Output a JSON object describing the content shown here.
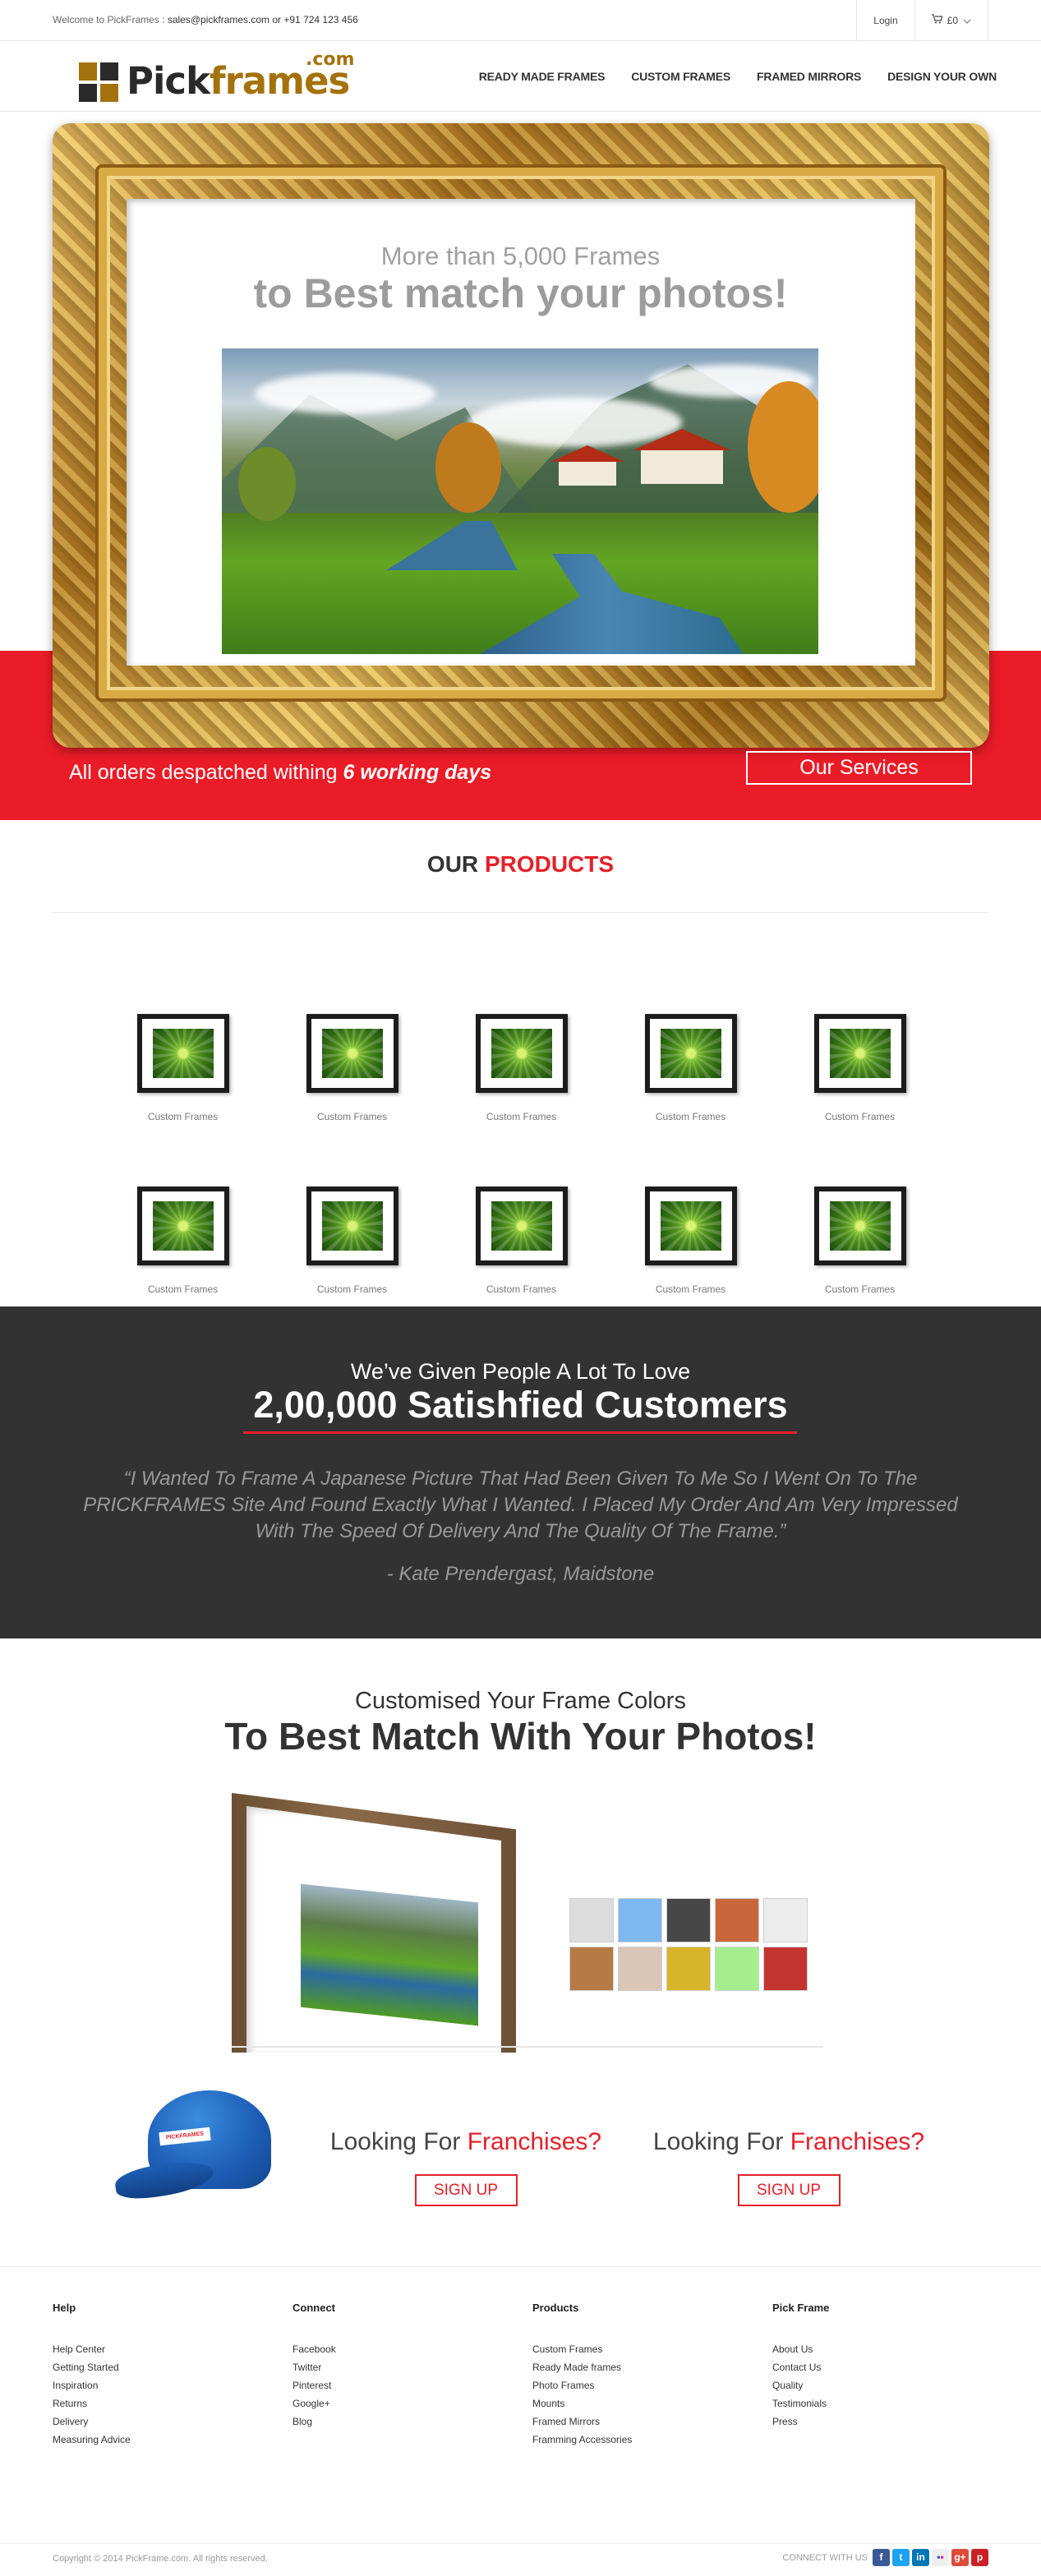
{
  "topbar": {
    "welcome_prefix": "Welcome to PickFrames :",
    "contact": "sales@pickframes.com or +91 724 123 456",
    "login": "Login",
    "cart": "£0"
  },
  "brand": {
    "pick": "Pick",
    "frames": "frames",
    "com": ".com"
  },
  "nav": [
    "READY MADE FRAMES",
    "CUSTOM FRAMES",
    "FRAMED MIRRORS",
    "DESIGN YOUR OWN"
  ],
  "hero": {
    "subtitle": "More than 5,000 Frames",
    "title": "to Best match your photos!",
    "despatch_text": "All orders despatched withing",
    "despatch_highlight": "6 working days",
    "services_button": "Our Services"
  },
  "products": {
    "heading_prefix": "OUR",
    "heading_highlight": "PRODUCTS",
    "items": [
      "Custom Frames",
      "Custom Frames",
      "Custom Frames",
      "Custom Frames",
      "Custom Frames",
      "Custom Frames",
      "Custom Frames",
      "Custom Frames",
      "Custom Frames",
      "Custom Frames"
    ]
  },
  "testimonial": {
    "lead": "We’ve Given People A Lot To Love",
    "headline": "2,00,000 Satishfied Customers",
    "quote": "“I Wanted To Frame A Japanese Picture That Had Been Given To Me So I Went On To The PRICKFRAMES Site And Found Exactly What I Wanted. I Placed My Order And Am Very Impressed With The Speed Of Delivery And The Quality Of The Frame.”",
    "author": "- Kate Prendergast, Maidstone"
  },
  "customise": {
    "lead": "Customised Your Frame Colors",
    "headline": "To Best Match With Your Photos!",
    "swatches": [
      "#dcdcdc",
      "#7fb8f0",
      "#474747",
      "#c9673c",
      "#ececec",
      "#b57a46",
      "#d9c6b6",
      "#d7b42a",
      "#a4ee8e",
      "#c33430"
    ]
  },
  "franchise": [
    {
      "prefix": "Looking For",
      "highlight": "Franchises?",
      "button": "SIGN UP"
    },
    {
      "prefix": "Looking For",
      "highlight": "Franchises?",
      "button": "SIGN UP"
    }
  ],
  "cap_badge": "PICKFRAMES",
  "footer": {
    "columns": [
      {
        "title": "Help",
        "links": [
          "Help Center",
          "Getting Started",
          "Inspiration",
          "Returns",
          "Delivery",
          "Measuring Advice"
        ]
      },
      {
        "title": "Connect",
        "links": [
          "Facebook",
          "Twitter",
          "Pinterest",
          "Google+",
          "Blog"
        ]
      },
      {
        "title": "Products",
        "links": [
          "Custom Frames",
          "Ready Made frames",
          "Photo Frames",
          "Mounts",
          "Framed Mirrors",
          "Framming Accessories"
        ]
      },
      {
        "title": "Pick Frame",
        "links": [
          "About Us",
          "Contact Us",
          "Quality",
          "Testimonials",
          "Press"
        ]
      }
    ],
    "copyright": "Copyright © 2014 PickFrame.com. All rights reserved.",
    "connect_label": "CONNECT WITH US",
    "social_icons": [
      "facebook-icon",
      "twitter-icon",
      "linkedin-icon",
      "flickr-icon",
      "google-plus-icon",
      "pinterest-icon"
    ]
  }
}
